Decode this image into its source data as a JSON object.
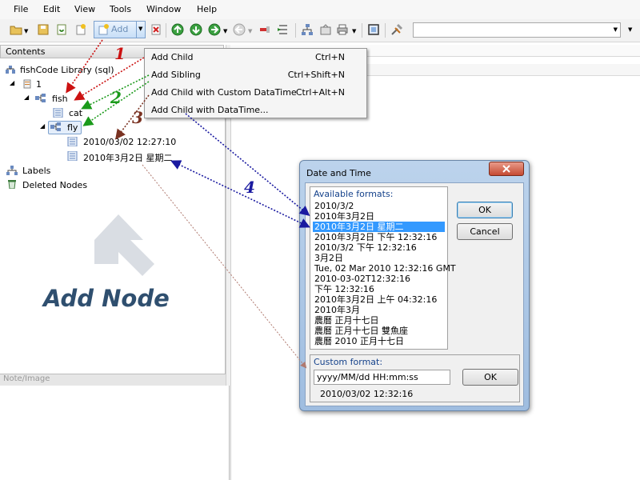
{
  "menubar": {
    "items": [
      "File",
      "Edit",
      "View",
      "Tools",
      "Window",
      "Help"
    ]
  },
  "toolbar": {
    "add_label": "Add"
  },
  "contents": {
    "title": "Contents",
    "tree": {
      "library": "fishCode Library (sql)",
      "node_1": "1",
      "fish": "fish",
      "cat": "cat",
      "fly": "fly",
      "date1": "2010/03/02 12:27:10",
      "date2": "2010年3月2日 星期二",
      "labels": "Labels",
      "deleted": "Deleted Nodes"
    },
    "note_title": "Note/Image"
  },
  "context_menu": {
    "items": [
      {
        "label": "Add Child",
        "shortcut": "Ctrl+N"
      },
      {
        "label": "Add Sibling",
        "shortcut": "Ctrl+Shift+N"
      },
      {
        "label": "Add Child with Custom DataTime",
        "shortcut": "Ctrl+Alt+N"
      },
      {
        "label": "Add Child with DataTime...",
        "shortcut": ""
      }
    ]
  },
  "dialog": {
    "title": "Date and Time",
    "available_label": "Available formats:",
    "formats": [
      "2010/3/2",
      "2010年3月2日",
      "2010年3月2日 星期二",
      "2010年3月2日 下午 12:32:16",
      "2010/3/2 下午 12:32:16",
      "3月2日",
      "Tue, 02 Mar 2010 12:32:16 GMT",
      "2010-03-02T12:32:16",
      "下午 12:32:16",
      "2010年3月2日 上午 04:32:16",
      "2010年3月",
      "農曆 正月十七日",
      "農曆 正月十七日 雙魚座",
      "農曆 2010 正月十七日"
    ],
    "selected_index": 2,
    "ok_label": "OK",
    "cancel_label": "Cancel",
    "custom_label": "Custom format:",
    "custom_value": "yyyy/MM/dd HH:mm:ss",
    "custom_ok_label": "OK",
    "custom_preview": "2010/03/02 12:32:16"
  },
  "annotations": {
    "heading": "Add Node",
    "steps": [
      "1",
      "2",
      "3",
      "4"
    ],
    "colors": {
      "step1": "#cc1111",
      "step2": "#1a9a1a",
      "step3": "#7a3222",
      "step4": "#1a1aa0"
    }
  }
}
